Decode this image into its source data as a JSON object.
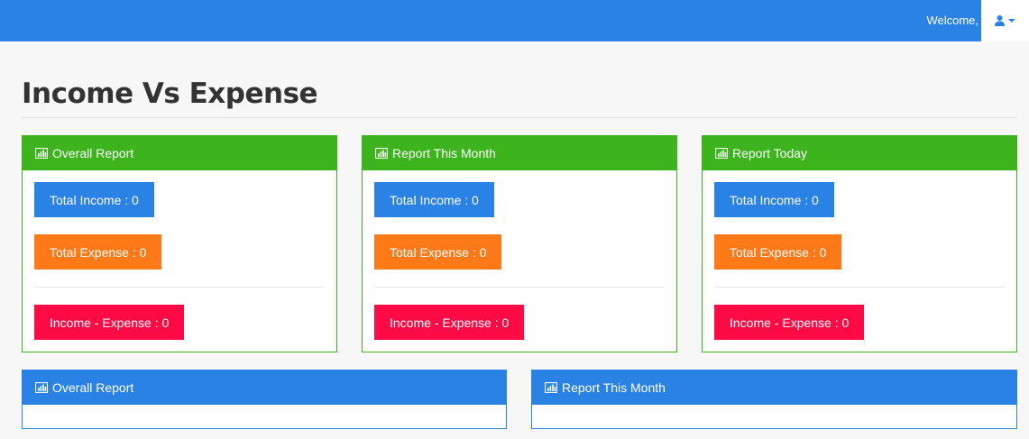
{
  "topbar": {
    "welcome_text": "Welcome,"
  },
  "page": {
    "title": "Income Vs Expense"
  },
  "panels": [
    {
      "title": "Overall Report",
      "income": "Total Income : 0",
      "expense": "Total Expense : 0",
      "diff": "Income - Expense : 0"
    },
    {
      "title": "Report This Month",
      "income": "Total Income : 0",
      "expense": "Total Expense : 0",
      "diff": "Income - Expense : 0"
    },
    {
      "title": "Report Today",
      "income": "Total Income : 0",
      "expense": "Total Expense : 0",
      "diff": "Income - Expense : 0"
    }
  ],
  "chart_panels": [
    {
      "title": "Overall Report"
    },
    {
      "title": "Report This Month"
    }
  ],
  "colors": {
    "primary": "#2a82e4",
    "success": "#3db41e",
    "warning": "#fe7a18",
    "danger": "#fe0a44"
  },
  "icons": {
    "user": "user-icon",
    "panel": "bar-chart-icon",
    "caret": "caret-down-icon"
  }
}
